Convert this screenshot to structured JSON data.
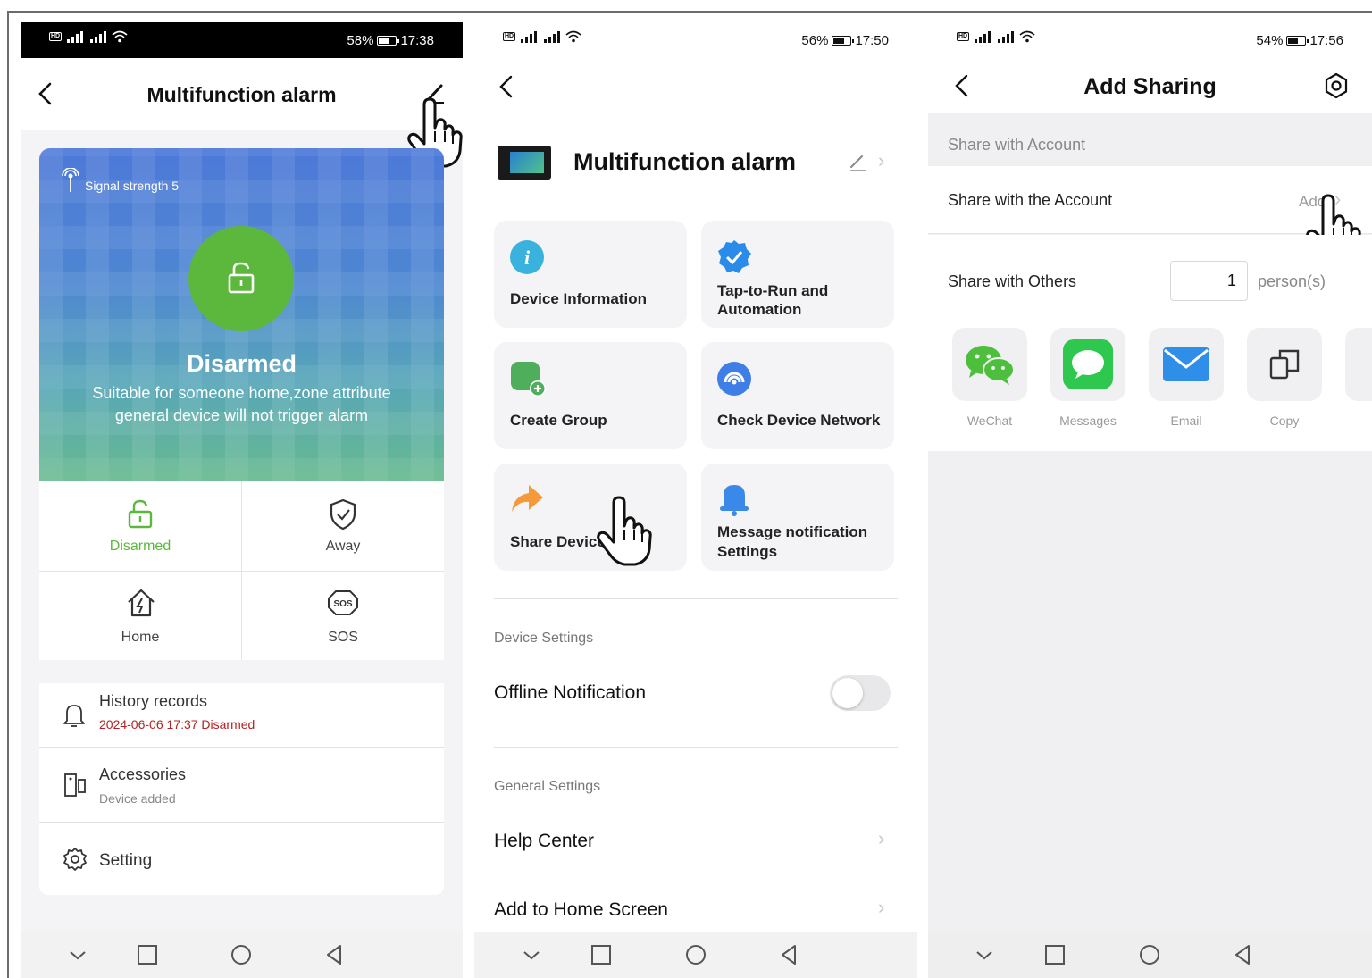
{
  "screen1": {
    "status": {
      "battery": "58%",
      "time": "17:38",
      "battery_level": 0.58
    },
    "title": "Multifunction alarm",
    "signal": "Signal strength 5",
    "state_title": "Disarmed",
    "state_desc_1": "Suitable for someone home,zone attribute",
    "state_desc_2": "general device will not trigger alarm",
    "modes": [
      {
        "label": "Disarmed",
        "icon": "unlock-icon"
      },
      {
        "label": "Away",
        "icon": "shield-check-icon"
      },
      {
        "label": "Home",
        "icon": "home-icon"
      },
      {
        "label": "SOS",
        "icon": "sos-icon"
      }
    ],
    "history_title": "History records",
    "history_sub": "2024-06-06 17:37 Disarmed",
    "accessories_title": "Accessories",
    "accessories_sub": "Device added",
    "setting_title": "Setting",
    "colors": {
      "accent_green": "#5cb83c",
      "history_red": "#b22222"
    }
  },
  "screen2": {
    "status": {
      "battery": "56%",
      "time": "17:50",
      "battery_level": 0.56
    },
    "device_name": "Multifunction alarm",
    "tiles": [
      {
        "label": "Device Information",
        "icon": "info-icon"
      },
      {
        "label": "Tap-to-Run and Automation",
        "icon": "check-badge-icon"
      },
      {
        "label": "Create Group",
        "icon": "create-group-icon"
      },
      {
        "label": "Check Device Network",
        "icon": "network-icon"
      },
      {
        "label": "Share Device",
        "icon": "share-arrow-icon"
      },
      {
        "label": "Message notification Settings",
        "icon": "bell-icon"
      }
    ],
    "device_settings_header": "Device Settings",
    "offline_notification": "Offline Notification",
    "general_settings_header": "General Settings",
    "help_center": "Help Center",
    "add_to_home": "Add to Home Screen"
  },
  "screen3": {
    "status": {
      "battery": "54%",
      "time": "17:56",
      "battery_level": 0.54
    },
    "title": "Add Sharing",
    "section_header": "Share with Account",
    "share_account_label": "Share with the Account",
    "share_account_action": "Add",
    "share_others_label": "Share with Others",
    "person_count": "1",
    "person_unit": "person(s)",
    "share_targets": [
      {
        "label": "WeChat",
        "icon": "wechat-icon"
      },
      {
        "label": "Messages",
        "icon": "messages-icon"
      },
      {
        "label": "Email",
        "icon": "email-icon"
      },
      {
        "label": "Copy",
        "icon": "copy-icon"
      }
    ]
  }
}
